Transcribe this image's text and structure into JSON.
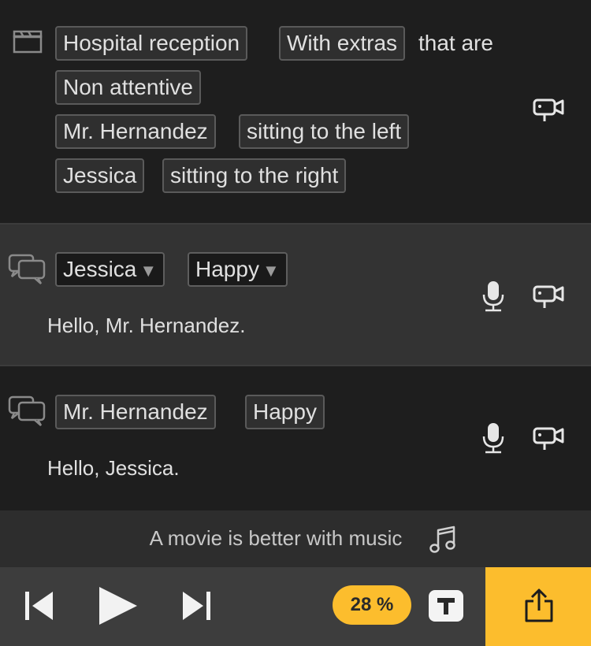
{
  "scene": {
    "location": "Hospital reception",
    "extras_tag": "With extras",
    "extras_suffix": "that are",
    "extras_attitude": "Non attentive",
    "character1": "Mr. Hernandez",
    "character1_position": "sitting to the left",
    "character2": "Jessica",
    "character2_position": "sitting to the right"
  },
  "lines": [
    {
      "character": "Jessica",
      "emotion": "Happy",
      "text": "Hello, Mr. Hernandez."
    },
    {
      "character": "Mr. Hernandez",
      "emotion": "Happy",
      "text": "Hello, Jessica."
    }
  ],
  "dropdown_caret": "▼",
  "music_prompt": "A movie is better with music",
  "toolbar": {
    "progress": "28 %"
  },
  "icons": {
    "scene": "clapperboard-icon",
    "dialog": "speech-bubbles-icon",
    "camera": "camera-icon",
    "mic": "microphone-icon",
    "music": "music-note-icon",
    "prev": "skip-previous-icon",
    "play": "play-icon",
    "next": "skip-next-icon",
    "title": "text-title-icon",
    "share": "share-icon"
  },
  "colors": {
    "accent": "#fcbd2d",
    "background": "#1e1e1e",
    "selected_row": "#333333"
  }
}
